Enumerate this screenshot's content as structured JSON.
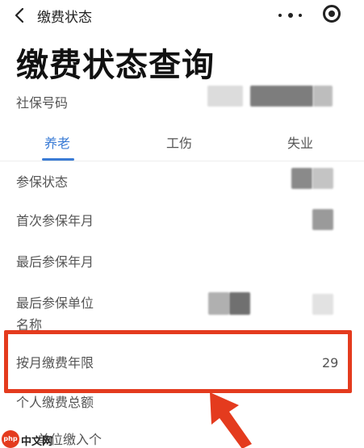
{
  "nav": {
    "title": "缴费状态"
  },
  "page_title": "缴费状态查询",
  "social_security": {
    "label": "社保号码"
  },
  "tabs": [
    {
      "label": "养老",
      "active": true
    },
    {
      "label": "工伤",
      "active": false
    },
    {
      "label": "失业",
      "active": false
    }
  ],
  "rows": [
    {
      "label": "参保状态"
    },
    {
      "label": "首次参保年月"
    },
    {
      "label": "最后参保年月"
    },
    {
      "label": "最后参保单位名称"
    },
    {
      "label": "按月缴费年限",
      "value": "29"
    },
    {
      "label": "个人缴费总额"
    },
    {
      "label": "单位缴入个"
    }
  ],
  "watermark": {
    "logo": "php",
    "text": "中文网"
  },
  "colors": {
    "accent": "#3a7bd5",
    "highlight": "#e43b1e"
  }
}
